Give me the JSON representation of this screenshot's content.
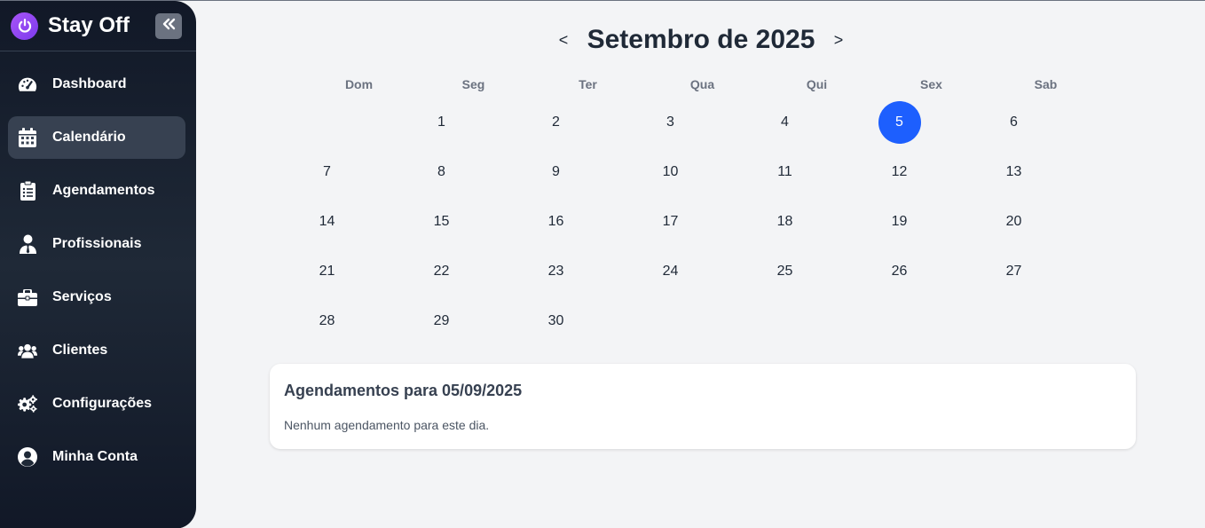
{
  "brand": {
    "name": "Stay Off",
    "logo_icon": "power-icon",
    "accent": "#8b5cf6"
  },
  "sidebar": {
    "collapse_icon": "double-chevron-left-icon",
    "items": [
      {
        "label": "Dashboard",
        "icon": "gauge-icon",
        "active": false
      },
      {
        "label": "Calendário",
        "icon": "calendar-icon",
        "active": true
      },
      {
        "label": "Agendamentos",
        "icon": "clipboard-icon",
        "active": false
      },
      {
        "label": "Profissionais",
        "icon": "user-tie-icon",
        "active": false
      },
      {
        "label": "Serviços",
        "icon": "briefcase-icon",
        "active": false
      },
      {
        "label": "Clientes",
        "icon": "users-icon",
        "active": false
      },
      {
        "label": "Configurações",
        "icon": "gears-icon",
        "active": false
      },
      {
        "label": "Minha Conta",
        "icon": "user-circle-icon",
        "active": false
      }
    ]
  },
  "calendar": {
    "prev_label": "<",
    "next_label": ">",
    "month_title": "Setembro de 2025",
    "weekdays": [
      "Dom",
      "Seg",
      "Ter",
      "Qua",
      "Qui",
      "Sex",
      "Sab"
    ],
    "first_weekday_offset": 1,
    "days": [
      "1",
      "2",
      "3",
      "4",
      "5",
      "6",
      "7",
      "8",
      "9",
      "10",
      "11",
      "12",
      "13",
      "14",
      "15",
      "16",
      "17",
      "18",
      "19",
      "20",
      "21",
      "22",
      "23",
      "24",
      "25",
      "26",
      "27",
      "28",
      "29",
      "30"
    ],
    "selected_day": "5",
    "selected_color": "#1d5ffe"
  },
  "appointments": {
    "title": "Agendamentos para 05/09/2025",
    "empty_text": "Nenhum agendamento para este dia."
  }
}
